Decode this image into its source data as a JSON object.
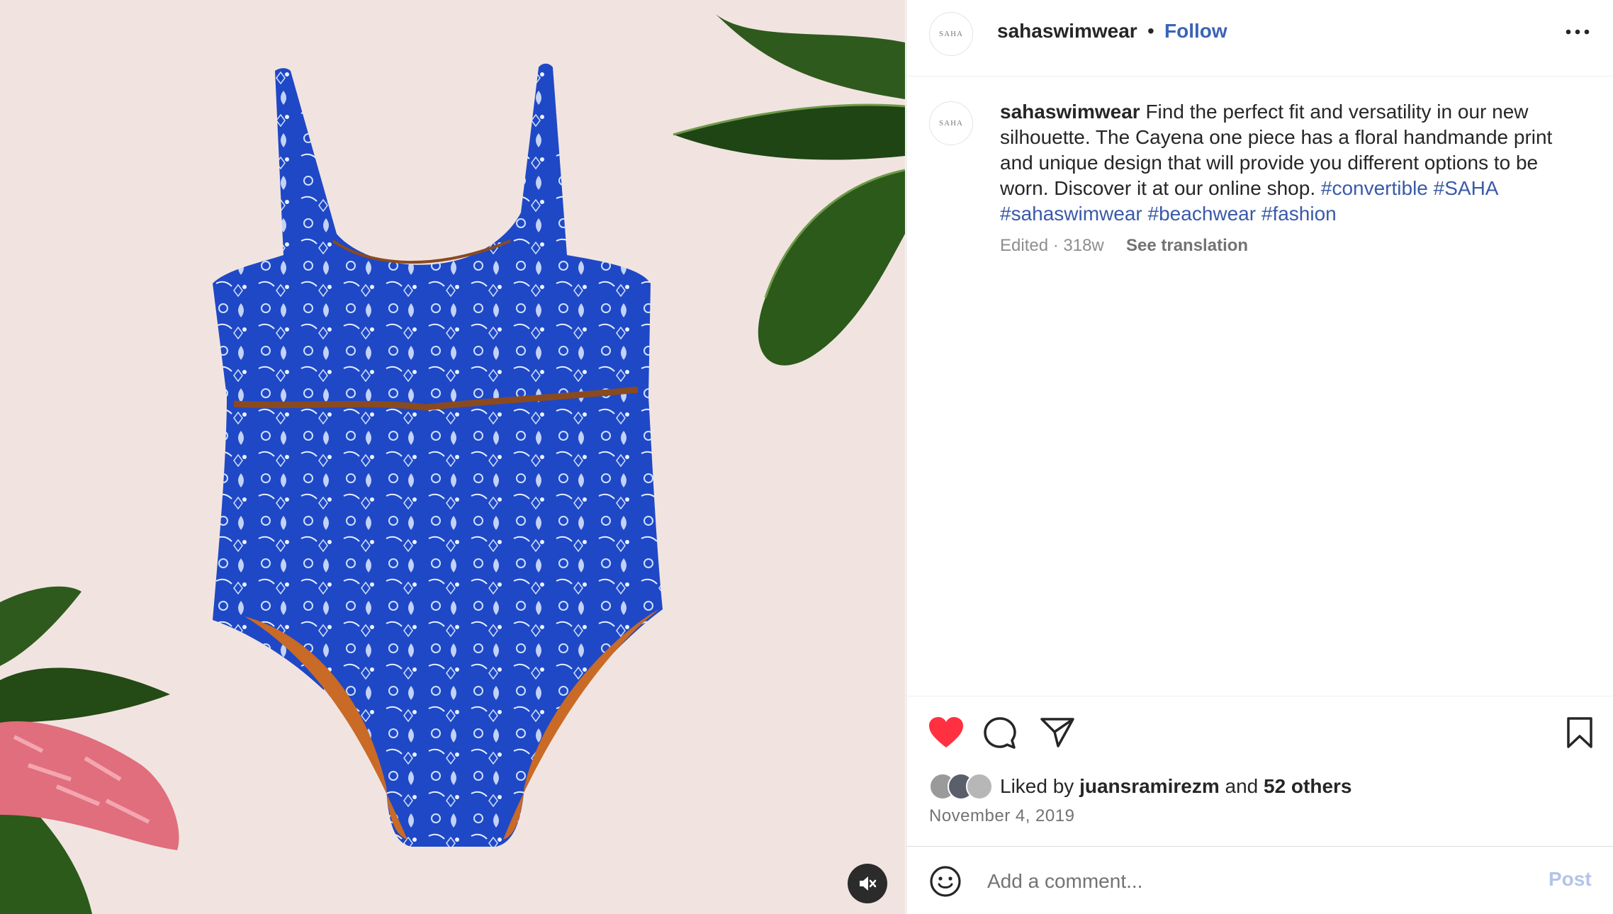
{
  "app": "Instagram post",
  "post": {
    "account_name": "sahaswimwear",
    "avatar_text": "SAHA",
    "follow_label": "Follow",
    "separator": "•",
    "caption_user": "sahaswimwear",
    "caption_text": "Find the perfect fit and versatility in our new silhouette. The Cayena one piece has a floral handmande print and unique design that will provide you different options to be worn. Discover it at our online shop.",
    "hashtags": [
      "#convertible",
      "#SAHA",
      "#sahaswimwear",
      "#beachwear",
      "#fashion"
    ],
    "meta": "Edited · 318w",
    "see_translation": "See translation"
  },
  "actions": {
    "liked": true,
    "like_icon": "heart-icon",
    "comment_icon": "comment-icon",
    "share_icon": "share-icon",
    "save_icon": "bookmark-icon",
    "accent_color": "#ff3040"
  },
  "likes": {
    "prefix": "Liked by",
    "user": "juansramirezm",
    "and": "and",
    "others": "52 others"
  },
  "date": "November 4, 2019",
  "comment": {
    "emoji_icon": "emoji-icon",
    "placeholder": "Add a comment...",
    "post_label": "Post"
  },
  "media": {
    "type": "video",
    "muted": true,
    "mute_icon": "speaker-muted-icon"
  },
  "colors": {
    "link": "#3a64b6",
    "hashtag": "#3a5aa8",
    "secondary_text": "#737373",
    "post_disabled": "#b3c4e8",
    "media_background": "#f1e4e0"
  }
}
